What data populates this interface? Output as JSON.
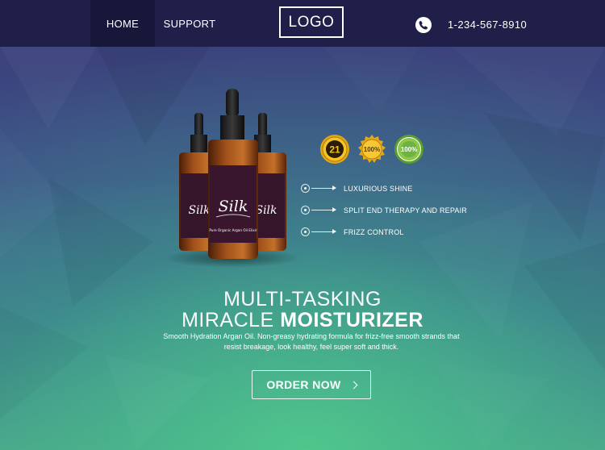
{
  "nav": {
    "items": [
      {
        "label": "HOME",
        "active": true
      },
      {
        "label": "SUPPORT",
        "active": false
      }
    ],
    "logo": "LOGO",
    "phone": {
      "icon": "phone-icon",
      "number": "1-234-567-8910"
    }
  },
  "product": {
    "brand": "Silk",
    "bottle_subtitle": "Pure Organic Argan Oil Elixir",
    "badges": [
      {
        "icon": "results-badge-icon",
        "number": "21",
        "color": "#f2b81c"
      },
      {
        "icon": "satisfaction-badge-icon",
        "number": "100%",
        "color": "#f0b21a"
      },
      {
        "icon": "natural-badge-icon",
        "number": "100%",
        "color": "#6cb33f"
      }
    ]
  },
  "features": [
    {
      "label": "LUXURIOUS SHINE"
    },
    {
      "label": "SPLIT END THERAPY AND REPAIR"
    },
    {
      "label": "FRIZZ CONTROL"
    }
  ],
  "hero": {
    "headline_line1_light": "MULTI-",
    "headline_line1_rest": "TASKING",
    "headline_line2_light": "MIRACLE ",
    "headline_line2_bold": "MOISTURIZER",
    "description": "Smooth Hydration Argan Oil. Non-greasy hydrating formula for frizz-free smooth strands that resist breakage, look healthy, feel super soft and thick.",
    "cta_label": "ORDER NOW"
  },
  "colors": {
    "nav_bg": "#1f1f4a",
    "nav_active_bg": "#17173a",
    "bg_top": "#3a3d78",
    "bg_bottom": "#4fb08a"
  }
}
